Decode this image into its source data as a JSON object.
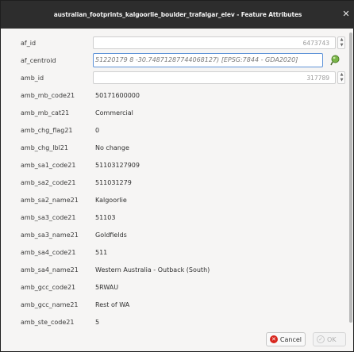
{
  "window": {
    "title": "australian_footprints_kalgoorlie_boulder_trafalgar_elev - Feature Attributes"
  },
  "fields": [
    {
      "label": "af_id",
      "value": "6473743",
      "kind": "number"
    },
    {
      "label": "af_centroid",
      "value": "51220179 8 -30.74871287744068127) [EPSG:7844 - GDA2020]",
      "kind": "geometry"
    },
    {
      "label": "amb_id",
      "value": "317789",
      "kind": "number"
    },
    {
      "label": "amb_mb_code21",
      "value": "50171600000",
      "kind": "text"
    },
    {
      "label": "amb_mb_cat21",
      "value": "Commercial",
      "kind": "text"
    },
    {
      "label": "amb_chg_flag21",
      "value": "0",
      "kind": "text"
    },
    {
      "label": "amb_chg_lbl21",
      "value": "No change",
      "kind": "text"
    },
    {
      "label": "amb_sa1_code21",
      "value": "51103127909",
      "kind": "text"
    },
    {
      "label": "amb_sa2_code21",
      "value": "511031279",
      "kind": "text"
    },
    {
      "label": "amb_sa2_name21",
      "value": "Kalgoorlie",
      "kind": "text"
    },
    {
      "label": "amb_sa3_code21",
      "value": "51103",
      "kind": "text"
    },
    {
      "label": "amb_sa3_name21",
      "value": "Goldfields",
      "kind": "text"
    },
    {
      "label": "amb_sa4_code21",
      "value": "511",
      "kind": "text"
    },
    {
      "label": "amb_sa4_name21",
      "value": "Western Australia - Outback (South)",
      "kind": "text"
    },
    {
      "label": "amb_gcc_code21",
      "value": "5RWAU",
      "kind": "text"
    },
    {
      "label": "amb_gcc_name21",
      "value": "Rest of WA",
      "kind": "text"
    },
    {
      "label": "amb_ste_code21",
      "value": "5",
      "kind": "text"
    }
  ],
  "buttons": {
    "cancel_label": "Cancel",
    "ok_label": "OK"
  },
  "icons": {
    "close": "close-icon",
    "geometry": "geometry-picker-icon",
    "cancel": "cancel-icon",
    "ok": "ok-icon"
  },
  "colors": {
    "focus_border": "#5e93d8",
    "cancel_icon": "#d8261d",
    "geometry_icon": "#7ab648"
  }
}
